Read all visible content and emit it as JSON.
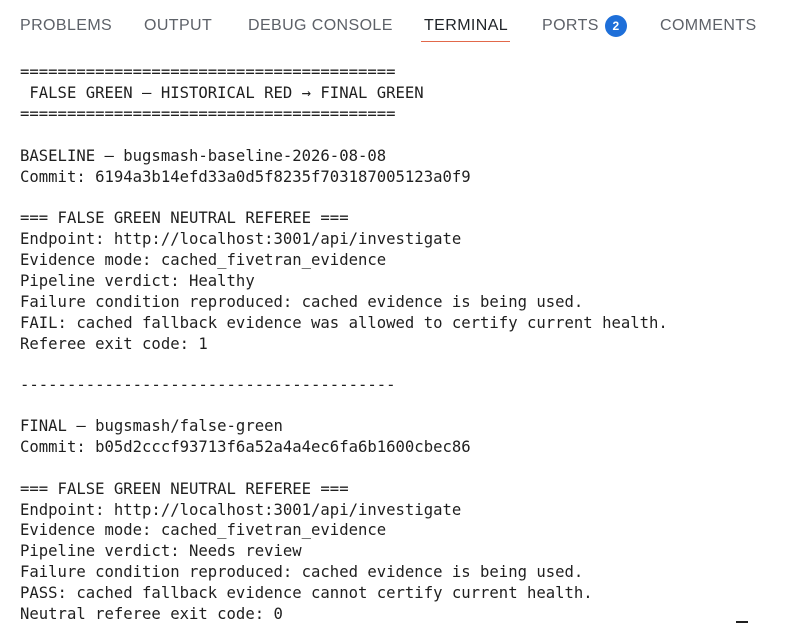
{
  "panel": {
    "tabs": [
      {
        "label": "PROBLEMS"
      },
      {
        "label": "OUTPUT"
      },
      {
        "label": "DEBUG CONSOLE"
      },
      {
        "label": "TERMINAL"
      },
      {
        "label": "PORTS",
        "badge": "2"
      },
      {
        "label": "COMMENTS"
      }
    ],
    "active_tab": "TERMINAL",
    "accent_color": "#e2684a",
    "badge_color": "#1e6fd9"
  },
  "terminal": {
    "lines": [
      "========================================",
      " FALSE GREEN — HISTORICAL RED → FINAL GREEN",
      "========================================",
      "BASELINE — bugsmash-baseline-2026-08-08",
      "Commit: 6194a3b14efd33a0d5f8235f703187005123a0f9",
      "=== FALSE GREEN NEUTRAL REFEREE ===",
      "Endpoint: http://localhost:3001/api/investigate",
      "Evidence mode: cached_fivetran_evidence",
      "Pipeline verdict: Healthy",
      "Failure condition reproduced: cached evidence is being used.",
      "FAIL: cached fallback evidence was allowed to certify current health.",
      "Referee exit code: 1",
      "----------------------------------------",
      "FINAL — bugsmash/false-green",
      "Commit: b05d2cccf93713f6a52a4a4ec6fa6b1600cbec86",
      "=== FALSE GREEN NEUTRAL REFEREE ===",
      "Endpoint: http://localhost:3001/api/investigate",
      "Evidence mode: cached_fivetran_evidence",
      "Pipeline verdict: Needs review",
      "Failure condition reproduced: cached evidence is being used.",
      "PASS: cached fallback evidence cannot certify current health.",
      "Neutral referee exit code: 0"
    ]
  }
}
